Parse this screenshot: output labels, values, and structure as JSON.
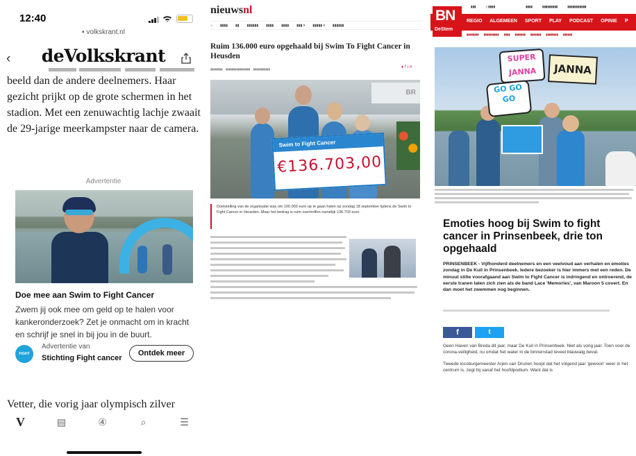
{
  "volkskrant": {
    "status": {
      "time": "12:40"
    },
    "url": "volkskrant.nl",
    "logo": "deVolkskrant",
    "article_paragraph": "beeld dan de andere deelnemers. Haar gezicht prijkt op de grote schermen in het stadion. Met een zenuwachtig lachje zwaait de 29-jarige meerkampster naar de camera.",
    "ad": {
      "label": "Advertentie",
      "title": "Doe mee aan Swim to Fight Cancer",
      "body": "Zwem jij ook mee om geld op te halen voor kankeronderzoek? Zet je onmacht om in kracht en schrijf je snel in bij jou in de buurt.",
      "from_label": "Advertentie van",
      "org": "Stichting Fight cancer",
      "logo_text": "FIGHT",
      "cta": "Ontdek meer"
    },
    "next_paragraph": "Vetter, die vorig jaar olympisch zilver",
    "tabs": [
      {
        "icon": "V",
        "icon_name": "home-icon"
      },
      {
        "icon": "▤",
        "icon_name": "newspaper-icon"
      },
      {
        "icon": "④",
        "icon_name": "topics-icon"
      },
      {
        "icon": "⌕",
        "icon_name": "search-icon"
      },
      {
        "icon": "☰",
        "icon_name": "menu-icon"
      }
    ]
  },
  "nieuwsnl": {
    "logo_main": "nieuws",
    "logo_accent": "nl",
    "title": "Ruim 136.000 euro opgehaald bij Swim To Fight Cancer in Heusden",
    "cheque_header": "Swim to Fight Cancer",
    "cheque_amount": "€136.703,00",
    "lead": "Doelstelling van de organisatie was om 100.000 euro op te gaan halen op zondag 18 september tijdens de Swim to Fight Cancer in Heusden. Maar het bedrag is ruim overtroffen namelijk 136.703 euro."
  },
  "bndestem": {
    "logo_main": "BN",
    "logo_sub": "DeStem",
    "nav": [
      "REGIO",
      "ALGEMEEN",
      "SPORT",
      "PLAY",
      "PODCAST",
      "OPINIE",
      "P"
    ],
    "signs": {
      "super": "SUPER JANNA",
      "janna": "JANNA",
      "gogo": "GO GO GO"
    },
    "title": "Emoties hoog bij Swim to fight cancer in Prinsenbeek, drie ton opgehaald",
    "lead": "PRINSENBEEK - Vijfhonderd deelnemers en een veelvoud aan verhalen en emoties zondag in De Kuil in Prinsenbeek. Iedere bezoeker is hier immers met een reden. De minuut stilte voorafgaand aan Swim to Fight Cancer is indringend en ontroerend, de eerste tranen laten zich zien als de band Lace 'Memories', van Maroon 5 covert. En dan moet het zwemmen nog beginnen.",
    "share_fb": "f",
    "share_tw": "t",
    "body_1": "Geen Haven van Breda dit jaar, maar De Kuil in Prinsenbeek. Niet als vorig jaar. Toen voor de corona-veiligheid, nu omdat het water in de binnenstad teveel blauwalg bevat.",
    "body_2": "Tweede locoburgemeester Arjen van Drunen hoopt dat het volgend jaar 'gewoon' weer in het centrum is, zegt hij vanaf het hoofdpodium. Want dat is"
  }
}
